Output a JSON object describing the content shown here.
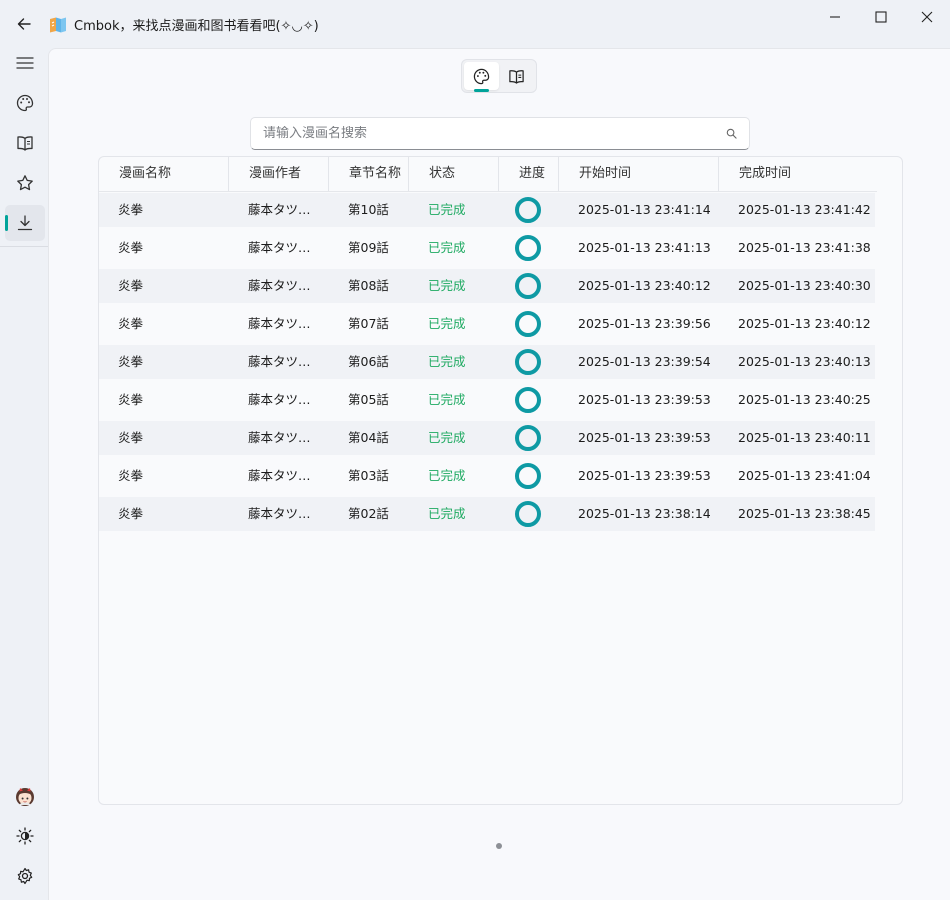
{
  "window": {
    "title": "Cmbok，来找点漫画和图书看看吧(✧◡✧)",
    "controls": [
      "minimize-icon",
      "maximize-icon",
      "close-icon"
    ]
  },
  "nav": {
    "items": [
      {
        "name": "menu",
        "icon": "hamburger-icon"
      },
      {
        "name": "comic",
        "icon": "palette-icon"
      },
      {
        "name": "book",
        "icon": "book-icon"
      },
      {
        "name": "favorites",
        "icon": "star-icon"
      },
      {
        "name": "downloads",
        "icon": "download-icon",
        "active": true
      }
    ],
    "bottom": [
      {
        "name": "avatar",
        "icon": "avatar-icon"
      },
      {
        "name": "theme",
        "icon": "brightness-icon"
      },
      {
        "name": "settings",
        "icon": "gear-icon"
      }
    ]
  },
  "segment": {
    "items": [
      {
        "icon": "palette-icon",
        "active": true
      },
      {
        "icon": "book-icon",
        "active": false
      }
    ]
  },
  "search": {
    "placeholder": "请输入漫画名搜索",
    "value": ""
  },
  "table": {
    "columns": [
      "漫画名称",
      "漫画作者",
      "章节名称",
      "状态",
      "进度",
      "开始时间",
      "完成时间"
    ],
    "rows": [
      {
        "name": "炎拳",
        "author": "藤本タツ…",
        "chapter": "第10話",
        "status": "已完成",
        "progress": 1,
        "start": "2025-01-13 23:41:14",
        "end": "2025-01-13 23:41:42"
      },
      {
        "name": "炎拳",
        "author": "藤本タツ…",
        "chapter": "第09話",
        "status": "已完成",
        "progress": 1,
        "start": "2025-01-13 23:41:13",
        "end": "2025-01-13 23:41:38"
      },
      {
        "name": "炎拳",
        "author": "藤本タツ…",
        "chapter": "第08話",
        "status": "已完成",
        "progress": 1,
        "start": "2025-01-13 23:40:12",
        "end": "2025-01-13 23:40:30"
      },
      {
        "name": "炎拳",
        "author": "藤本タツ…",
        "chapter": "第07話",
        "status": "已完成",
        "progress": 1,
        "start": "2025-01-13 23:39:56",
        "end": "2025-01-13 23:40:12"
      },
      {
        "name": "炎拳",
        "author": "藤本タツ…",
        "chapter": "第06話",
        "status": "已完成",
        "progress": 1,
        "start": "2025-01-13 23:39:54",
        "end": "2025-01-13 23:40:13"
      },
      {
        "name": "炎拳",
        "author": "藤本タツ…",
        "chapter": "第05話",
        "status": "已完成",
        "progress": 1,
        "start": "2025-01-13 23:39:53",
        "end": "2025-01-13 23:40:25"
      },
      {
        "name": "炎拳",
        "author": "藤本タツ…",
        "chapter": "第04話",
        "status": "已完成",
        "progress": 1,
        "start": "2025-01-13 23:39:53",
        "end": "2025-01-13 23:40:11"
      },
      {
        "name": "炎拳",
        "author": "藤本タツ…",
        "chapter": "第03話",
        "status": "已完成",
        "progress": 1,
        "start": "2025-01-13 23:39:53",
        "end": "2025-01-13 23:41:04"
      },
      {
        "name": "炎拳",
        "author": "藤本タツ…",
        "chapter": "第02話",
        "status": "已完成",
        "progress": 1,
        "start": "2025-01-13 23:38:14",
        "end": "2025-01-13 23:38:45"
      }
    ]
  },
  "colors": {
    "accent": "#00a39a",
    "status_done": "#1faa62",
    "progress_ring": "#0e9aa4"
  }
}
